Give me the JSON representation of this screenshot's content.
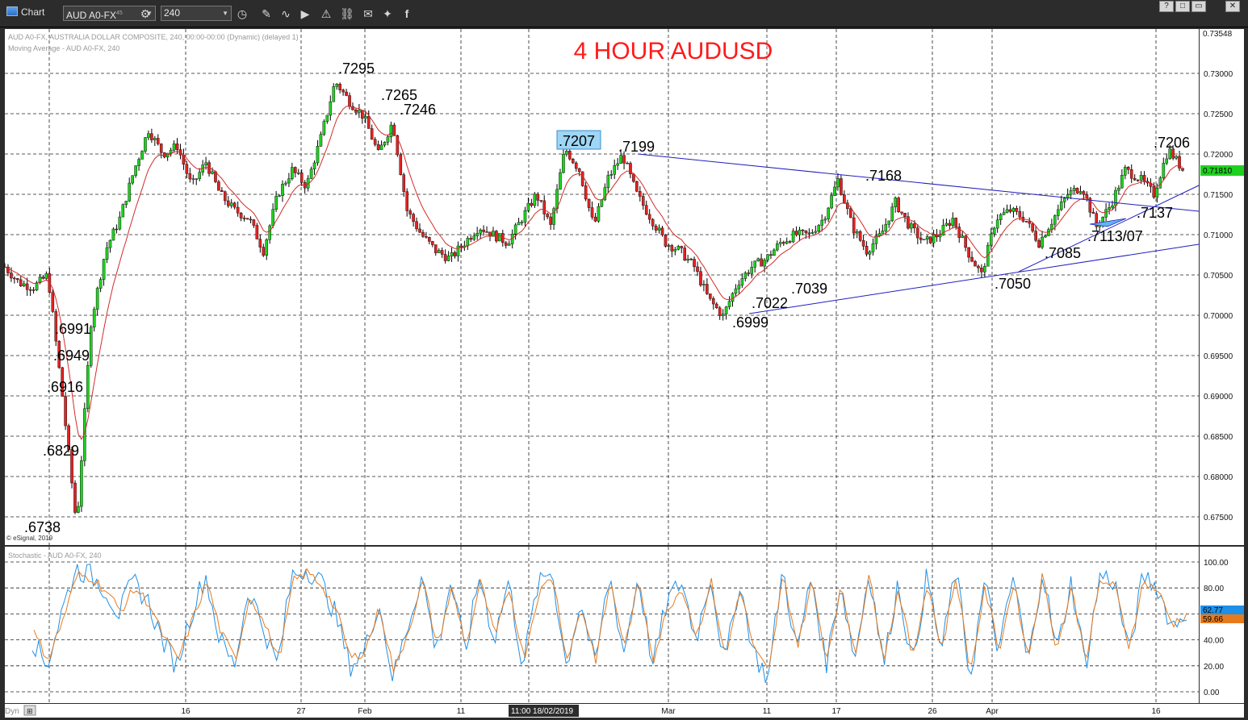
{
  "toolbar": {
    "window_title": "Chart",
    "symbol": "AUD A0-FX",
    "symbol_superscript": "45",
    "interval": "240"
  },
  "window_buttons": [
    "?",
    "□",
    "▭",
    "✕"
  ],
  "legend": {
    "main_line1": "AUD A0-FX, AUSTRALIA DOLLAR COMPOSITE, 240, 00:00-00:00 (Dynamic) (delayed 1)",
    "main_line2": "Moving Average - AUD A0-FX, 240",
    "sub_line": "Stochastic - AUD A0-FX, 240",
    "copyright": "© eSignal, 2019",
    "dyn_label": "Dyn"
  },
  "chart_data": [
    {
      "type": "line",
      "title": "4 HOUR AUDUSD",
      "xlabel": "",
      "ylabel": "",
      "ylim": [
        0.6715,
        0.7355
      ],
      "grid": true,
      "legend": "none",
      "y_ticks": [
        "0.67500",
        "0.68000",
        "0.68500",
        "0.69000",
        "0.69500",
        "0.70000",
        "0.70500",
        "0.71000",
        "0.71500",
        "0.72000",
        "0.72500",
        "0.73000"
      ],
      "y_top_label": "0.73548",
      "x_ticks": [
        "16",
        "27",
        "Feb",
        "11",
        "Mar",
        "11",
        "17",
        "26",
        "Apr",
        "16"
      ],
      "x_cursor_label": "11:00 18/02/2019",
      "last_price": "0.71810",
      "series": [
        {
          "values_approx": [
            0.706,
            0.704,
            0.7035,
            0.705,
            0.69,
            0.6738,
            0.6991,
            0.708,
            0.712,
            0.718,
            0.723,
            0.72,
            0.721,
            0.716,
            0.719,
            0.715,
            0.713,
            0.712,
            0.708,
            0.715,
            0.718,
            0.716,
            0.722,
            0.729,
            0.7265,
            0.7246,
            0.72,
            0.724,
            0.713,
            0.71,
            0.708,
            0.707,
            0.709,
            0.711,
            0.71,
            0.709,
            0.712,
            0.715,
            0.711,
            0.7207,
            0.718,
            0.711,
            0.717,
            0.7199,
            0.715,
            0.712,
            0.709,
            0.708,
            0.706,
            0.702,
            0.6999,
            0.704,
            0.706,
            0.707,
            0.709,
            0.71,
            0.71,
            0.712,
            0.7168,
            0.711,
            0.708,
            0.71,
            0.714,
            0.711,
            0.709,
            0.71,
            0.712,
            0.708,
            0.705,
            0.712,
            0.713,
            0.712,
            0.709,
            0.712,
            0.715,
            0.716,
            0.711,
            0.7137,
            0.718,
            0.717,
            0.715,
            0.7206,
            0.7181
          ]
        }
      ],
      "annotations": [
        ".7295",
        ".7265",
        ".7246",
        ".7207",
        ".7199",
        ".7168",
        ".7206",
        ".7137",
        ".7113/07",
        ".7085",
        ".7050",
        ".7039",
        ".7022",
        ".6999",
        ".6991",
        ".6949",
        ".6916",
        ".6829",
        ".6738"
      ]
    },
    {
      "type": "line",
      "title": "",
      "ylim": [
        0,
        100
      ],
      "y_ticks": [
        "0.00",
        "20.00",
        "40.00",
        "60.00",
        "80.00",
        "100.00"
      ],
      "last_k": "62.77",
      "last_d": "59.66",
      "series": [
        {
          "values_approx": [
            40,
            20,
            60,
            95,
            90,
            80,
            60,
            85,
            70,
            40,
            20,
            60,
            90,
            40,
            20,
            80,
            50,
            20,
            90,
            95,
            85,
            60,
            20,
            30,
            70,
            10,
            50,
            90,
            30,
            85,
            30,
            90,
            40,
            85,
            20,
            80,
            95,
            20,
            70,
            20,
            90,
            30,
            90,
            20,
            70,
            85,
            40,
            90,
            20,
            85,
            30,
            10,
            95,
            30,
            90,
            20,
            85,
            25,
            95,
            20,
            85,
            20,
            90,
            30,
            95,
            10,
            85,
            30,
            90,
            20,
            95,
            30,
            85,
            20,
            90,
            85,
            30,
            90,
            80,
            50,
            62.77
          ]
        },
        {
          "values_approx": [
            45,
            25,
            55,
            90,
            88,
            78,
            62,
            80,
            68,
            42,
            25,
            55,
            85,
            45,
            25,
            75,
            52,
            25,
            85,
            92,
            82,
            62,
            25,
            32,
            65,
            15,
            48,
            85,
            35,
            80,
            35,
            85,
            42,
            80,
            25,
            75,
            90,
            25,
            65,
            25,
            85,
            35,
            85,
            25,
            65,
            80,
            42,
            85,
            25,
            80,
            32,
            15,
            90,
            35,
            85,
            25,
            80,
            30,
            90,
            25,
            80,
            25,
            85,
            32,
            90,
            15,
            80,
            32,
            85,
            25,
            90,
            32,
            80,
            25,
            85,
            82,
            35,
            85,
            78,
            52,
            59.66
          ]
        }
      ]
    }
  ],
  "colors": {
    "up_candle": "#1fd11f",
    "down_candle": "#e32222",
    "wick": "#000000",
    "ma_line": "#d42a2a",
    "trend_line": "#1f1fbf",
    "title_red": "#ff1a1a",
    "stoch_k": "#1e90e8",
    "stoch_d": "#e87a1e",
    "grid": "#222222",
    "frame": "#2c2c2c",
    "last_price_bg": "#1fd11f",
    "stoch_k_bg": "#1e90e8",
    "stoch_d_bg": "#e87a1e",
    "highlight_box": "#9fd6f5"
  }
}
